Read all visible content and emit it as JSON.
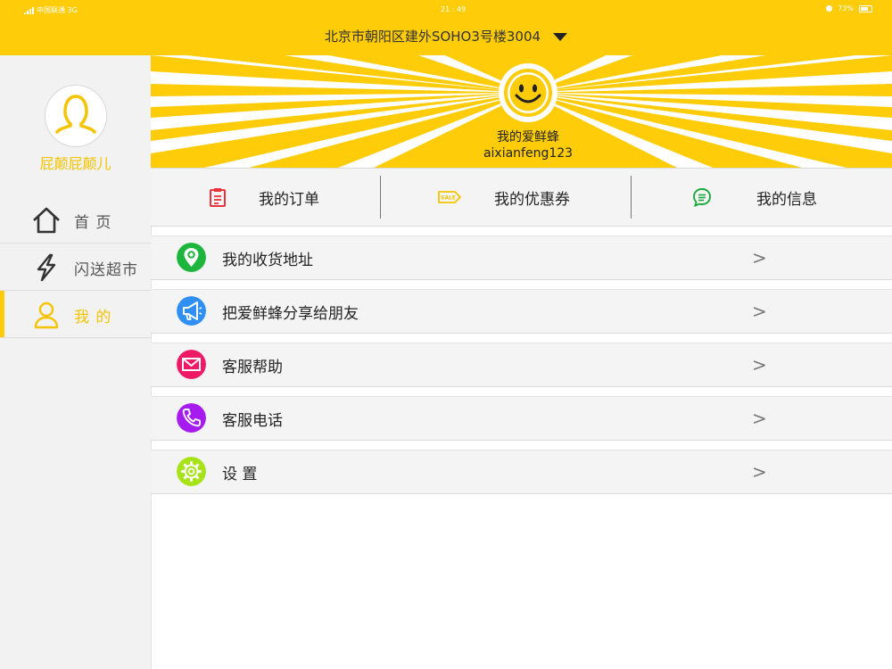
{
  "status_bar": {
    "carrier": "中国联通 3G",
    "time": "21 : 49",
    "battery": "73%"
  },
  "header": {
    "address": "北京市朝阳区建外SOHO3号楼3004"
  },
  "sidebar": {
    "username": "屁颠屁颠儿",
    "items": [
      {
        "label": "首 页",
        "icon": "home-icon"
      },
      {
        "label": "闪送超市",
        "icon": "lightning-icon"
      },
      {
        "label": "我 的",
        "icon": "user-icon",
        "active": true
      }
    ]
  },
  "banner": {
    "title": "我的爱鲜蜂",
    "account": "aixianfeng123"
  },
  "tabs": [
    {
      "label": "我的订单",
      "icon": "clipboard-icon",
      "color": "#e8333a"
    },
    {
      "label": "我的优惠券",
      "icon": "sale-tag-icon",
      "color": "#f5c400"
    },
    {
      "label": "我的信息",
      "icon": "message-icon",
      "color": "#1aaa3c"
    }
  ],
  "menu": [
    {
      "label": "我的收货地址",
      "icon": "location-pin-icon",
      "color": "#1db53c"
    },
    {
      "label": "把爱鲜蜂分享给朋友",
      "icon": "megaphone-icon",
      "color": "#2f8ff2"
    },
    {
      "label": "客服帮助",
      "icon": "mail-icon",
      "color": "#ee1a66"
    },
    {
      "label": "客服电话",
      "icon": "phone-icon",
      "color": "#a51bf0"
    },
    {
      "label": "设 置",
      "icon": "gear-icon",
      "color": "#a8e31a"
    }
  ],
  "chevron": ">",
  "accent": "#ffcc0a"
}
